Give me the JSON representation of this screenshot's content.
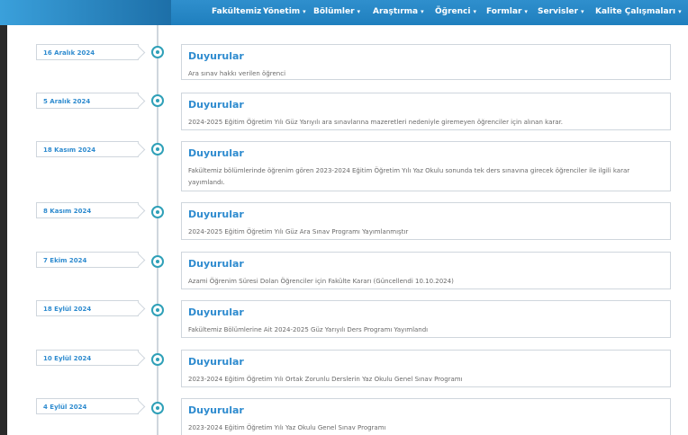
{
  "nav": {
    "items": [
      {
        "label": "Fakültemiz"
      },
      {
        "label": "Yönetim"
      },
      {
        "label": "Bölümler"
      },
      {
        "label": "Araştırma"
      },
      {
        "label": "Öğrenci"
      },
      {
        "label": "Formlar"
      },
      {
        "label": "Servisler"
      },
      {
        "label": "Kalite Çalışmaları"
      }
    ],
    "caret": "▾"
  },
  "timeline": [
    {
      "date": "16 Aralık 2024",
      "title": "Duyurular",
      "text": "Ara sınav hakkı verilen öğrenci"
    },
    {
      "date": "5 Aralık 2024",
      "title": "Duyurular",
      "text": "2024-2025 Eğitim Öğretim Yılı Güz Yarıyılı ara sınavlarına mazeretleri nedeniyle giremeyen öğrenciler için alınan karar."
    },
    {
      "date": "18 Kasım 2024",
      "title": "Duyurular",
      "text": "Fakültemiz bölümlerinde öğrenim gören 2023-2024 Eğitim Öğretim Yılı Yaz Okulu sonunda tek ders sınavına girecek öğrenciler ile ilgili karar yayımlandı."
    },
    {
      "date": "8 Kasım 2024",
      "title": "Duyurular",
      "text": "2024-2025 Eğitim Öğretim Yılı Güz Ara Sınav Programı Yayımlanmıştır"
    },
    {
      "date": "7 Ekim 2024",
      "title": "Duyurular",
      "text": "Azami Öğrenim Süresi Dolan Öğrenciler için Fakülte Kararı (Güncellendi 10.10.2024)"
    },
    {
      "date": "18 Eylül 2024",
      "title": "Duyurular",
      "text": "Fakültemiz Bölümlerine Ait 2024-2025 Güz Yarıyılı Ders Programı Yayımlandı"
    },
    {
      "date": "10 Eylül 2024",
      "title": "Duyurular",
      "text": "2023-2024 Eğitim Öğretim Yılı Ortak Zorunlu Derslerin Yaz Okulu Genel Sınav Programı"
    },
    {
      "date": "4 Eylül 2024",
      "title": "Duyurular",
      "text": "2023-2024 Eğitim Öğretim Yılı Yaz Okulu Genel Sınav Programı"
    }
  ]
}
